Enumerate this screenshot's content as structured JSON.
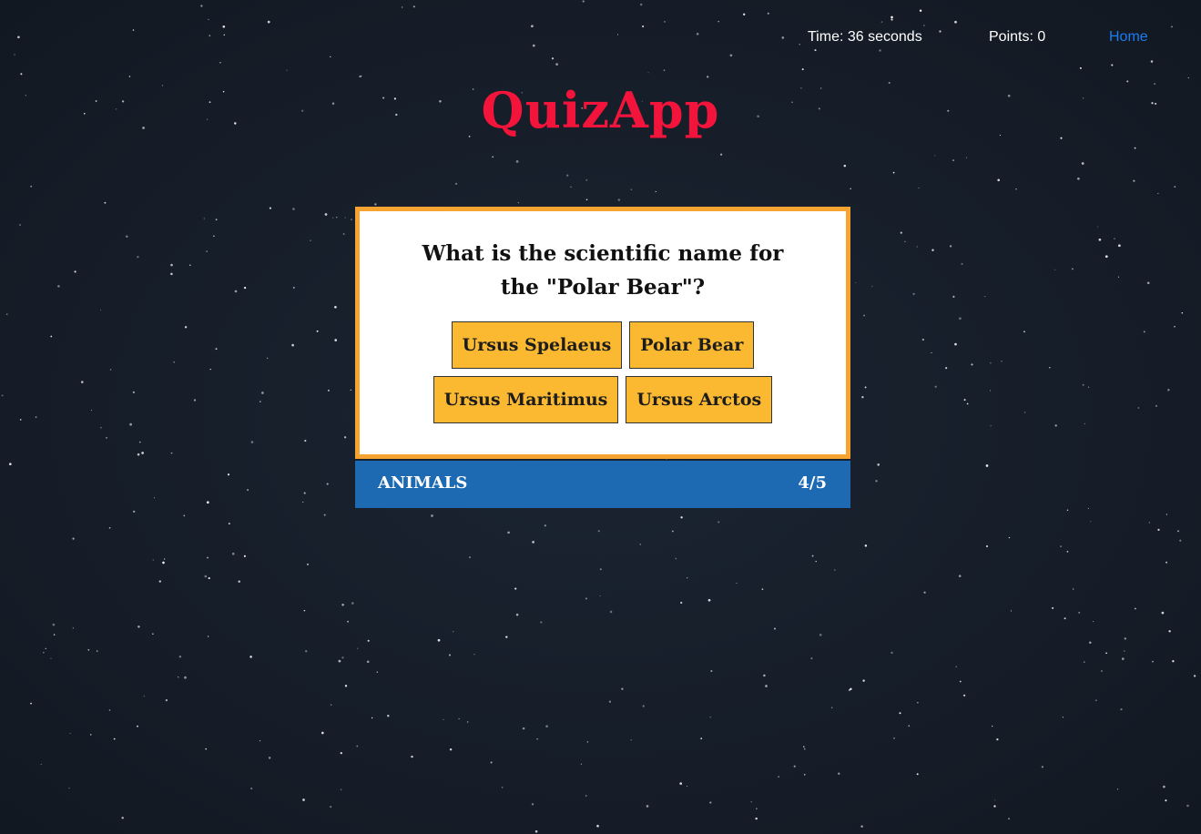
{
  "header": {
    "timer_text": "Time: 36 seconds",
    "points_text": "Points: 0",
    "home_link": "Home"
  },
  "app": {
    "title": "QuizApp"
  },
  "quiz": {
    "question": "What is the scientific name for the \"Polar Bear\"?",
    "answers": [
      {
        "label": "Ursus Spelaeus"
      },
      {
        "label": "Polar Bear"
      },
      {
        "label": "Ursus Maritimus"
      },
      {
        "label": "Ursus Arctos"
      }
    ],
    "category": "ANIMALS",
    "progress": "4/5"
  },
  "colors": {
    "background": "#1b2432",
    "title": "#f2143a",
    "card_border": "#f7a331",
    "answer_bg": "#fbb931",
    "footer_bg": "#1d6ab3",
    "link": "#1a7cf2"
  }
}
